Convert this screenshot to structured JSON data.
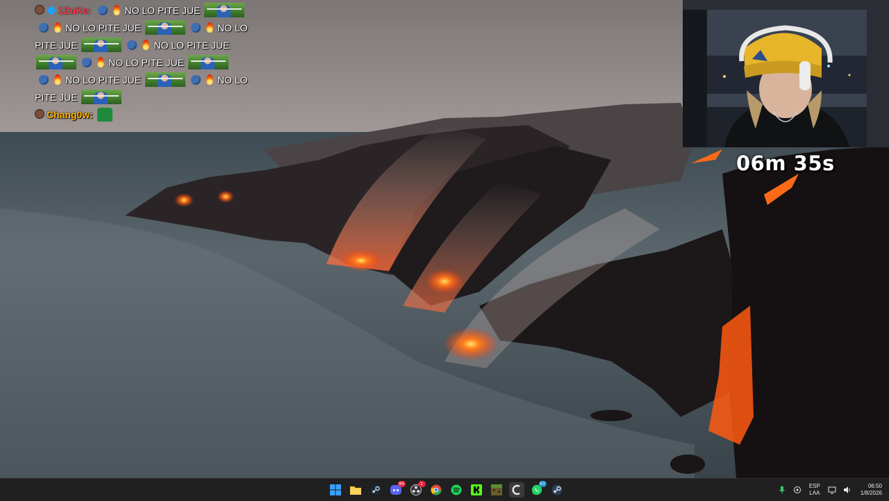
{
  "chat": {
    "messages": [
      {
        "user": "1ZuKe",
        "user_color": "#ff3a4a",
        "text_lines": [
          "NO LO PITE JUE",
          "NO LO PITE JUE",
          "NO LO",
          "PITE JUE",
          "NO LO PITE JUE",
          "NO LO PITE JUE",
          "NO LO PITE JUE",
          "NO LO",
          "PITE JUE"
        ],
        "emotes": [
          "punch-emote",
          "fire-emote",
          "messi-image-emote"
        ]
      },
      {
        "user": "Chang0w",
        "user_color": "#ffb400",
        "emotes": [
          "green-block-emote"
        ]
      }
    ]
  },
  "timer": {
    "text": "06m 35s"
  },
  "taskbar": {
    "apps": [
      {
        "name": "windows-start",
        "color": "#3aa0ff"
      },
      {
        "name": "file-explorer",
        "color": "#f4c542"
      },
      {
        "name": "steam",
        "color": "#7aa7d8"
      },
      {
        "name": "discord",
        "color": "#5865f2",
        "badge": "99"
      },
      {
        "name": "obs",
        "color": "#cfcfcf",
        "badge": "1"
      },
      {
        "name": "chrome",
        "color": "#e04a3a"
      },
      {
        "name": "spotify",
        "color": "#1ed760"
      },
      {
        "name": "kick",
        "color": "#53fc18"
      },
      {
        "name": "minecraft",
        "color": "#8a7a3a"
      },
      {
        "name": "cursor",
        "color": "#ffffff"
      },
      {
        "name": "whatsapp",
        "color": "#25d366",
        "badge": "63"
      },
      {
        "name": "steam-2",
        "color": "#9ab4d8"
      }
    ],
    "tray": {
      "language": "ESP",
      "layout": "LAA",
      "time": "06:50",
      "date": "1/8/2026"
    }
  }
}
